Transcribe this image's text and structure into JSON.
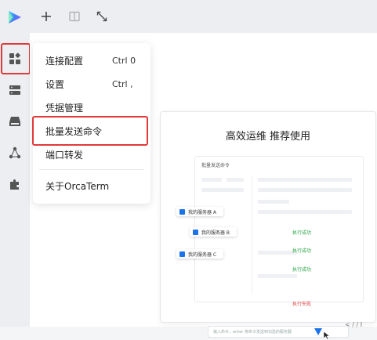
{
  "menu": {
    "items": [
      {
        "label": "连接配置",
        "shortcut": "Ctrl 0"
      },
      {
        "label": "设置",
        "shortcut": "Ctrl ,"
      },
      {
        "label": "凭据管理",
        "shortcut": ""
      },
      {
        "label": "批量发送命令",
        "shortcut": ""
      },
      {
        "label": "端口转发",
        "shortcut": ""
      },
      {
        "label": "关于OrcaTerm",
        "shortcut": ""
      }
    ]
  },
  "promo": {
    "title": "高效运维 推荐使用",
    "preview": {
      "title": "批量发送命令",
      "servers": [
        "我的服务器 A",
        "我的服务器 B",
        "我的服务器 C"
      ],
      "statuses": [
        "执行成功",
        "执行成功",
        "执行成功",
        "执行失败"
      ],
      "command_placeholder": "输入命令，enter 将命令发送到勾选的服务器"
    }
  },
  "bottom_text": "< / / I",
  "colors": {
    "highlight": "#e03a3a",
    "accent": "#1a73e8",
    "success": "#2da84a",
    "fail": "#e04646"
  },
  "icons": {
    "logo": "orcaterm-logo",
    "sidebar": [
      "apps-icon",
      "server-icon",
      "drive-icon",
      "share-icon",
      "plugin-icon"
    ],
    "toolbar": [
      "plus-icon",
      "split-icon",
      "expand-icon"
    ]
  }
}
